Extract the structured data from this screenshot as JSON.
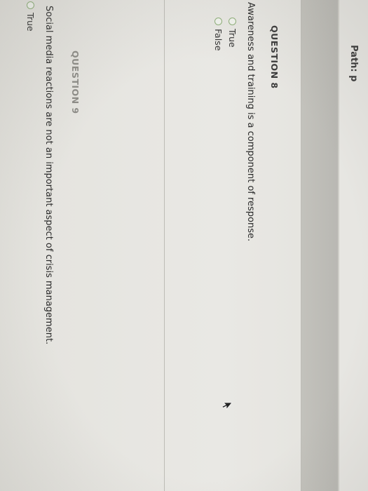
{
  "path_bar": {
    "label": "Path: p"
  },
  "questions": [
    {
      "heading": "QUESTION 8",
      "text": "Awareness and training is a component of response.",
      "options": [
        "True",
        "False"
      ]
    },
    {
      "heading": "QUESTION 9",
      "text": "Social media reactions are not an important aspect of crisis management.",
      "options": [
        "True"
      ]
    }
  ],
  "colors": {
    "radio_border": "#8fb07a",
    "grey_band": "#c3c2bc",
    "background": "#e9e8e4"
  },
  "icons": [
    "mouse-pointer-icon"
  ]
}
